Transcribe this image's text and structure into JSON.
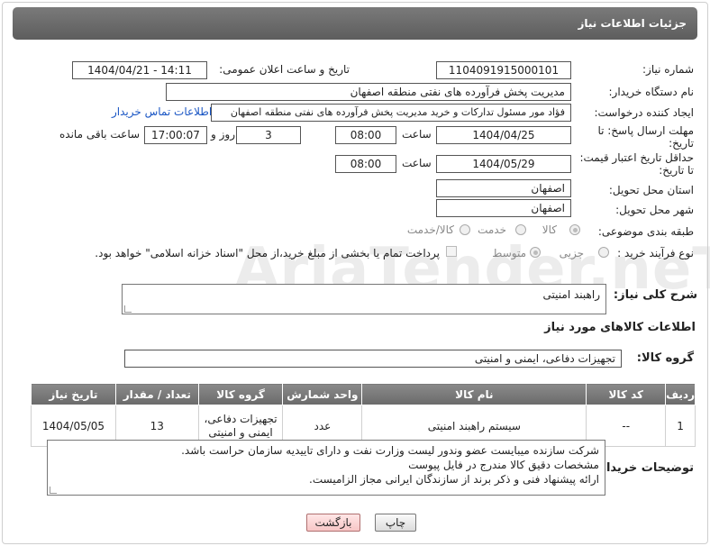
{
  "header": {
    "title": "جزئیات اطلاعات نیاز"
  },
  "fields": {
    "need_number": {
      "label": "شماره نیاز:",
      "value": "1104091915000101"
    },
    "announce_datetime": {
      "label": "تاریخ و ساعت اعلان عمومی:",
      "value": "1404/04/21 - 14:11"
    },
    "buyer_org": {
      "label": "نام دستگاه خریدار:",
      "value": "مدیریت پخش فرآورده های نفتی منطقه اصفهان"
    },
    "requester": {
      "label": "ایجاد کننده درخواست:",
      "value": "فؤاد مور مسئول تدارکات و خرید مدیریت پخش فرآورده های نفتی منطقه اصفهان",
      "link": "اطلاعات تماس خریدار"
    },
    "reply_deadline": {
      "label_line1": "مهلت ارسال پاسخ: تا",
      "label_line2": "تاریخ:",
      "date": "1404/04/25",
      "time_label": "ساعت",
      "time": "08:00",
      "days": "3",
      "days_label": "روز و",
      "remaining": "17:00:07",
      "remaining_label": "ساعت باقی مانده"
    },
    "price_validity": {
      "label_line1": "حداقل تاریخ اعتبار قیمت:",
      "label_line2": "تا تاریخ:",
      "date": "1404/05/29",
      "time_label": "ساعت",
      "time": "08:00"
    },
    "delivery_province": {
      "label": "استان محل تحویل:",
      "value": "اصفهان"
    },
    "delivery_city": {
      "label": "شهر محل تحویل:",
      "value": "اصفهان"
    },
    "category": {
      "label": "طبقه بندی موضوعی:",
      "options": [
        "کالا",
        "خدمت",
        "کالا/خدمت"
      ],
      "selected": "کالا"
    },
    "process_type": {
      "label": "نوع فرآیند خرید :",
      "options": [
        "جزیی",
        "متوسط"
      ],
      "selected": "متوسط",
      "payment_note": "پرداخت تمام یا بخشی از مبلغ خرید،از محل \"اسناد خزانه اسلامی\" خواهد بود."
    }
  },
  "description": {
    "label": "شرح کلی نیاز:",
    "value": "راهبند امنیتی"
  },
  "goods_section": {
    "title": "اطلاعات کالاهای مورد نیاز",
    "group_label": "گروه کالا:",
    "group_value": "تجهیزات دفاعی، ایمنی و امنیتی"
  },
  "table": {
    "headers": [
      "ردیف",
      "کد کالا",
      "نام کالا",
      "واحد شمارش",
      "گروه کالا",
      "تعداد / مقدار",
      "تاریخ نیاز"
    ],
    "rows": [
      {
        "row": "1",
        "code": "--",
        "name": "سیستم راهبند امنیتی",
        "unit": "عدد",
        "group_line1": "تجهیزات دفاعی،",
        "group_line2": "ایمنی و امنیتی",
        "qty": "13",
        "date": "1404/05/05"
      }
    ]
  },
  "buyer_notes": {
    "label": "توضیحات خریدار:",
    "lines": [
      "شرکت سازنده میبایست عضو وندور لیست وزارت نفت و دارای تاییدیه سازمان حراست باشد.",
      "مشخصات دقیق کالا مندرج در فایل پیوست",
      "ارائه پیشنهاد فنی و ذکر برند از سازندگان ایرانی مجاز الزامیست."
    ]
  },
  "buttons": {
    "print": "چاپ",
    "back": "بازگشت"
  },
  "watermark": "AriaTender.neT"
}
